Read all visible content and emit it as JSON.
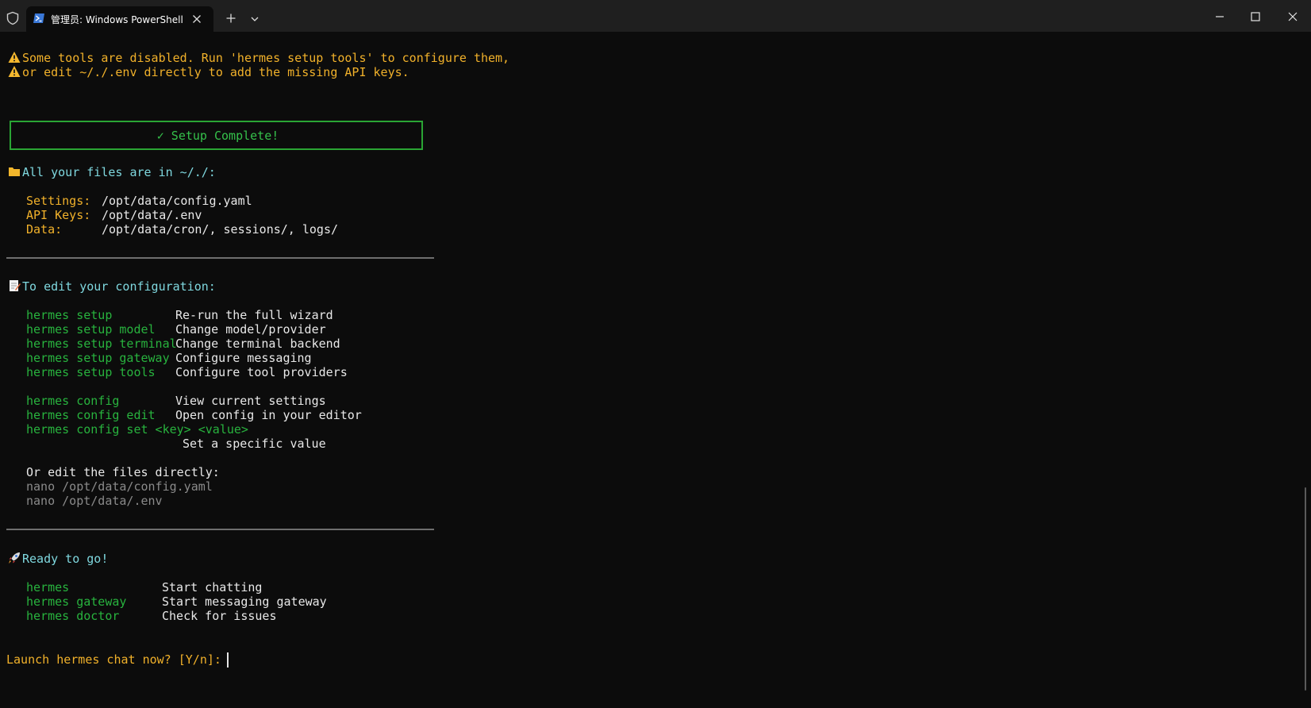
{
  "window": {
    "tab_title": "管理员: Windows PowerShell",
    "icons": {
      "shield": "shield-icon",
      "powershell": "powershell-icon",
      "close_tab": "close-icon",
      "new_tab": "plus-icon",
      "dropdown": "chevron-down-icon",
      "minimize": "minimize-icon",
      "maximize": "maximize-icon",
      "close_window": "close-icon"
    }
  },
  "colors": {
    "background": "#0c0c0c",
    "warning": "#f1b12a",
    "heading": "#7fd8df",
    "command": "#28b33e",
    "muted": "#8a8a8a"
  },
  "warning": {
    "line1": "Some tools are disabled. Run 'hermes setup tools' to configure them,",
    "line2": "or edit ~/./.env directly to add the missing API keys."
  },
  "setup_banner": "✓ Setup Complete!",
  "files": {
    "heading": "All your files are in ~/./:",
    "rows": [
      {
        "label": "Settings:",
        "value": "/opt/data/config.yaml"
      },
      {
        "label": "API Keys:",
        "value": "/opt/data/.env"
      },
      {
        "label": "Data:",
        "value": "/opt/data/cron/, sessions/, logs/"
      }
    ]
  },
  "config": {
    "heading": "To edit your configuration:",
    "setup_commands": [
      {
        "cmd": "hermes setup",
        "desc": "Re-run the full wizard"
      },
      {
        "cmd": "hermes setup model",
        "desc": "Change model/provider"
      },
      {
        "cmd": "hermes setup terminal",
        "desc": "Change terminal backend"
      },
      {
        "cmd": "hermes setup gateway",
        "desc": "Configure messaging"
      },
      {
        "cmd": "hermes setup tools",
        "desc": "Configure tool providers"
      }
    ],
    "config_commands": [
      {
        "cmd": "hermes config",
        "desc": "View current settings"
      },
      {
        "cmd": "hermes config edit",
        "desc": "Open config in your editor"
      }
    ],
    "config_set_cmd": "hermes config set <key> <value>",
    "config_set_desc": "Set a specific value",
    "direct_label": "Or edit the files directly:",
    "direct_files": [
      "nano /opt/data/config.yaml",
      "nano /opt/data/.env"
    ]
  },
  "ready": {
    "heading": "Ready to go!",
    "commands": [
      {
        "cmd": "hermes",
        "desc": "Start chatting"
      },
      {
        "cmd": "hermes gateway",
        "desc": "Start messaging gateway"
      },
      {
        "cmd": "hermes doctor",
        "desc": "Check for issues"
      }
    ]
  },
  "prompt": "Launch hermes chat now? [Y/n]: "
}
